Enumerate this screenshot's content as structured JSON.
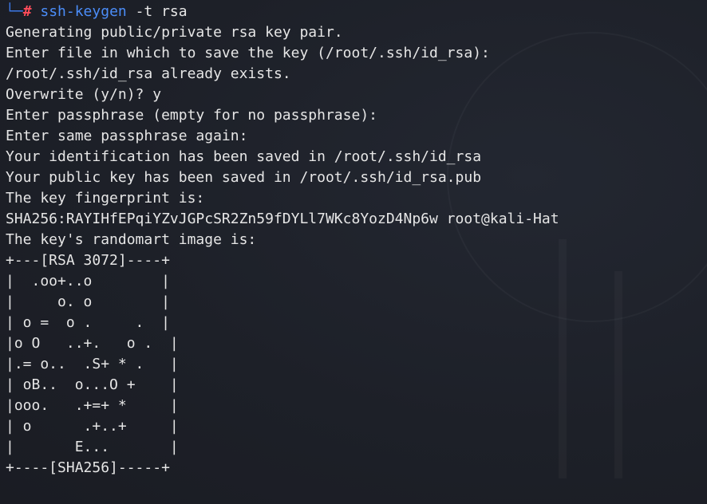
{
  "prompt": {
    "branch": "└─",
    "symbol": "#",
    "command": "ssh-keygen",
    "args": " -t rsa"
  },
  "output_lines": [
    "Generating public/private rsa key pair.",
    "Enter file in which to save the key (/root/.ssh/id_rsa):",
    "/root/.ssh/id_rsa already exists.",
    "Overwrite (y/n)? y",
    "Enter passphrase (empty for no passphrase):",
    "Enter same passphrase again:",
    "Your identification has been saved in /root/.ssh/id_rsa",
    "Your public key has been saved in /root/.ssh/id_rsa.pub",
    "The key fingerprint is:",
    "SHA256:RAYIHfEPqiYZvJGPcSR2Zn59fDYLl7WKc8YozD4Np6w root@kali-Hat",
    "The key's randomart image is:",
    "+---[RSA 3072]----+",
    "|  .oo+..o        |",
    "|     o. o        |",
    "| o =  o .     .  |",
    "|o O   ..+.   o .  |",
    "|.= o..  .S+ * .   |",
    "| oB..  o...O +    |",
    "|ooo.   .+=+ *     |",
    "| o      .+..+     |",
    "|       E...       |",
    "+----[SHA256]-----+"
  ],
  "colors": {
    "background": "#1c1f26",
    "text": "#e6e6e6",
    "prompt_branch": "#3c78e6",
    "prompt_root": "#ff4c5a",
    "command": "#4b8df8"
  }
}
